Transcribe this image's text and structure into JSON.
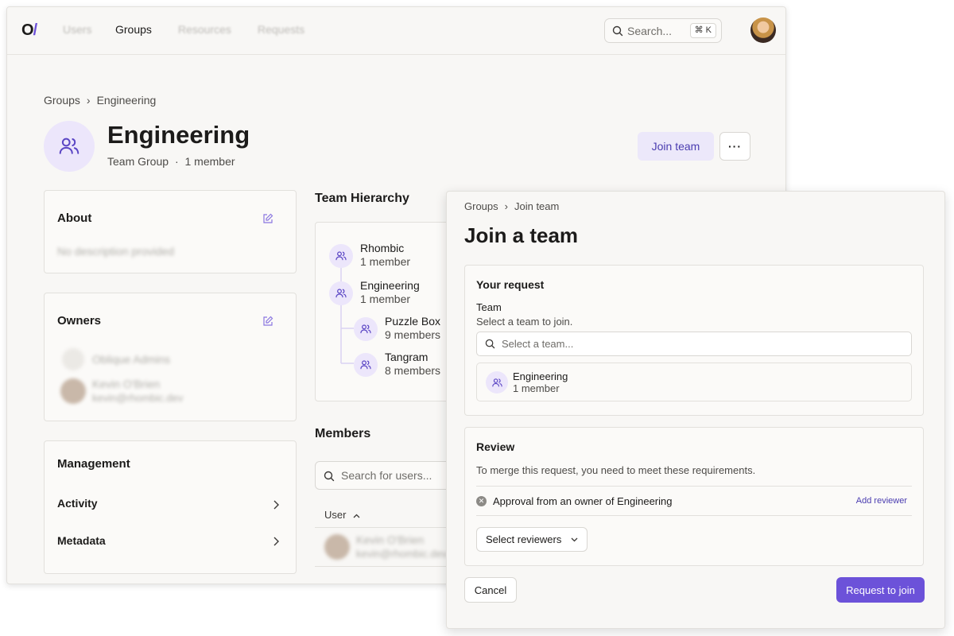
{
  "nav": {
    "logo_main": "O",
    "logo_slash": "/",
    "items": [
      "Users",
      "Groups",
      "Resources",
      "Requests"
    ],
    "search_placeholder": "Search...",
    "search_shortcut": "⌘ K"
  },
  "breadcrumb": {
    "root": "Groups",
    "current": "Engineering",
    "separator": "›"
  },
  "group": {
    "title": "Engineering",
    "type": "Team Group",
    "dot": "·",
    "members": "1 member",
    "join_label": "Join team",
    "more_label": "···"
  },
  "about": {
    "title": "About",
    "description": "No description provided"
  },
  "owners": {
    "title": "Owners",
    "group_owner": "Oblique Admins",
    "person_name": "Kevin O'Brien",
    "person_email": "kevin@rhombic.dev"
  },
  "management": {
    "title": "Management",
    "items": [
      "Activity",
      "Metadata"
    ]
  },
  "hierarchy": {
    "title": "Team Hierarchy",
    "nodes": [
      {
        "name": "Rhombic",
        "count": "1 member"
      },
      {
        "name": "Engineering",
        "count": "1 member"
      },
      {
        "name": "Puzzle Box",
        "count": "9 members"
      },
      {
        "name": "Tangram",
        "count": "8 members"
      }
    ]
  },
  "members": {
    "title": "Members",
    "search_placeholder": "Search for users...",
    "column_user": "User",
    "row_name": "Kevin O'Brien",
    "row_email": "kevin@rhombic.dev"
  },
  "dialog": {
    "breadcrumb_root": "Groups",
    "breadcrumb_current": "Join team",
    "title": "Join a team",
    "request": {
      "title": "Your request",
      "team_label": "Team",
      "team_hint": "Select a team to join.",
      "select_placeholder": "Select a team...",
      "selected_name": "Engineering",
      "selected_count": "1 member"
    },
    "review": {
      "title": "Review",
      "description": "To merge this request, you need to meet these requirements.",
      "requirement_prefix": "Approval from an owner of",
      "requirement_team": "Engineering",
      "add_reviewer": "Add reviewer",
      "select_reviewers": "Select reviewers"
    },
    "cancel_label": "Cancel",
    "submit_label": "Request to join"
  },
  "colors": {
    "accent": "#6c52d9",
    "accent_soft": "#ece6fb",
    "background": "#f8f7f5"
  }
}
